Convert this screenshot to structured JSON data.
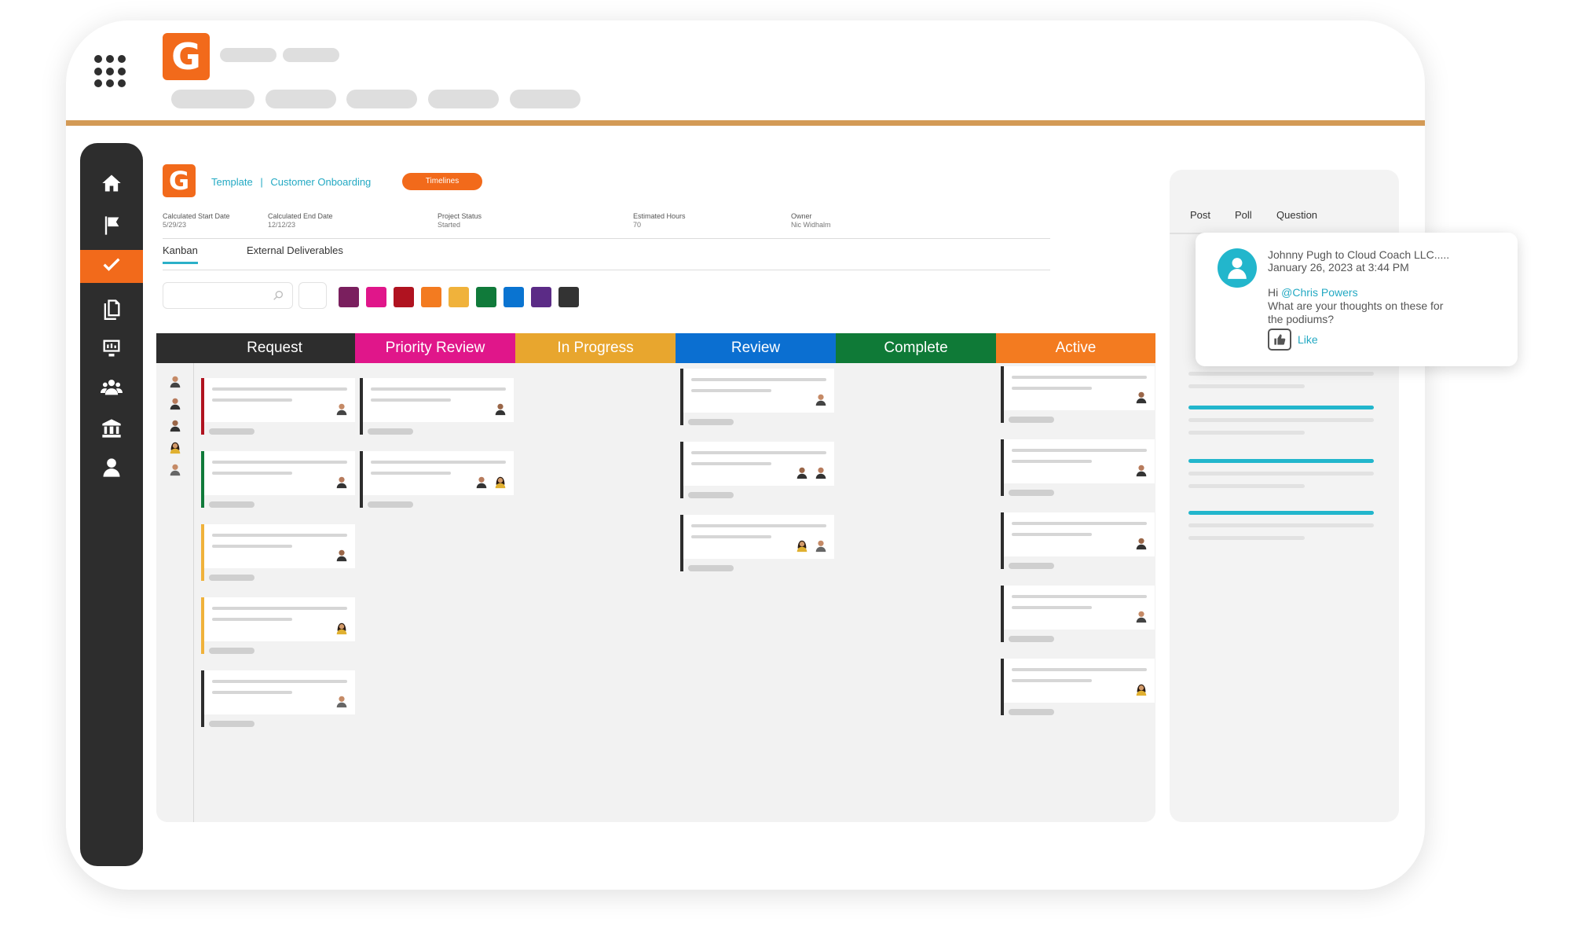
{
  "breadcrumb": {
    "template": "Template",
    "separator": "|",
    "project": "Customer Onboarding"
  },
  "tag_label": "Timelines",
  "meta": [
    {
      "label": "Calculated Start Date",
      "value": "5/29/23"
    },
    {
      "label": "Calculated End Date",
      "value": "12/12/23"
    },
    {
      "label": "Project Status",
      "value": "Started"
    },
    {
      "label": "Estimated Hours",
      "value": "70"
    },
    {
      "label": "Owner",
      "value": "Nic Widhalm"
    }
  ],
  "tabs": [
    "Kanban",
    "External Deliverables"
  ],
  "swatches": [
    "#7a1f5e",
    "#e0168a",
    "#b01320",
    "#f37b20",
    "#f0b23b",
    "#107a3a",
    "#0a74d1",
    "#5b2b86",
    "#333333"
  ],
  "columns": [
    {
      "label": "Request",
      "color": "#2d2d2d"
    },
    {
      "label": "Priority Review",
      "color": "#e0168a"
    },
    {
      "label": "In Progress",
      "color": "#e8a62e"
    },
    {
      "label": "Review",
      "color": "#0b6fd1"
    },
    {
      "label": "Complete",
      "color": "#0f7a37"
    },
    {
      "label": "Active",
      "color": "#f37b20"
    }
  ],
  "sidebar_icons": [
    "home-icon",
    "flag-icon",
    "check-icon",
    "documents-icon",
    "report-icon",
    "team-icon",
    "bank-icon",
    "user-icon"
  ],
  "panel_tabs": [
    "Post",
    "Poll",
    "Question"
  ],
  "comment": {
    "author_line": "Johnny Pugh to Cloud Coach LLC.....",
    "timestamp": "January 26, 2023 at 3:44 PM",
    "greeting": "Hi ",
    "mention": "@Chris Powers",
    "line1": "What are your thoughts on these for",
    "line2": "the podiums?",
    "like_label": "Like"
  },
  "colors": {
    "brand": "#f26a1b",
    "accent": "#23a9c3",
    "sidebar": "#2d2d2d"
  }
}
